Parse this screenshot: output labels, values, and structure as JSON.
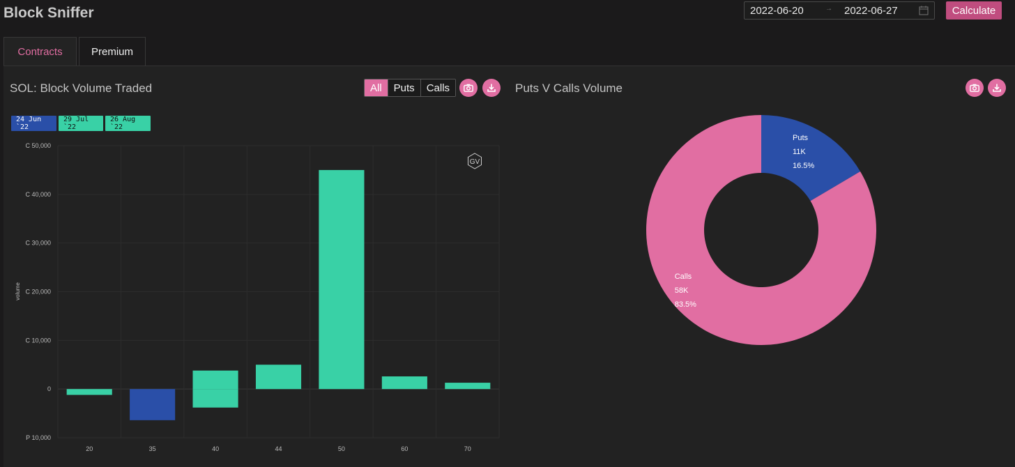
{
  "app": {
    "title": "Block Sniffer"
  },
  "date_range": {
    "start": "2022-06-20",
    "end": "2022-06-27",
    "separator": "→"
  },
  "calculate_label": "Calculate",
  "tabs": [
    {
      "label": "Contracts"
    },
    {
      "label": "Premium"
    }
  ],
  "bar_card": {
    "title": "SOL: Block Volume Traded",
    "filters": [
      "All",
      "Puts",
      "Calls"
    ],
    "active_filter": "All",
    "expiries": [
      {
        "label": "24 Jun `22",
        "color": "#2a4fa8"
      },
      {
        "label": "29 Jul `22",
        "color": "#39d1a6"
      },
      {
        "label": "26 Aug `22",
        "color": "#39d1a6"
      }
    ],
    "watermark": "GV"
  },
  "donut_card": {
    "title": "Puts V Calls Volume"
  },
  "colors": {
    "accent": "#e16ea2",
    "puts": "#2a4fa8",
    "calls_bar": "#39d1a6",
    "calls_pie": "#e16ea2"
  },
  "chart_data": [
    {
      "type": "bar",
      "ylabel": "volume",
      "categories": [
        "20",
        "35",
        "40",
        "44",
        "50",
        "60",
        "70"
      ],
      "ylim": [
        -10000,
        50000
      ],
      "yticks": [
        {
          "value": 50000,
          "label": "C 50,000"
        },
        {
          "value": 40000,
          "label": "C 40,000"
        },
        {
          "value": 30000,
          "label": "C 30,000"
        },
        {
          "value": 20000,
          "label": "C 20,000"
        },
        {
          "value": 10000,
          "label": "C 10,000"
        },
        {
          "value": 0,
          "label": "0"
        },
        {
          "value": -10000,
          "label": "P 10,000"
        }
      ],
      "bars": [
        {
          "category": "20",
          "value": -1200,
          "color": "#39d1a6"
        },
        {
          "category": "35",
          "value": -6400,
          "color": "#2a4fa8"
        },
        {
          "category": "40",
          "value": 3800,
          "color": "#39d1a6"
        },
        {
          "category": "40",
          "value": -3800,
          "color": "#39d1a6"
        },
        {
          "category": "44",
          "value": 5000,
          "color": "#39d1a6"
        },
        {
          "category": "50",
          "value": 45000,
          "color": "#39d1a6"
        },
        {
          "category": "60",
          "value": 2600,
          "color": "#39d1a6"
        },
        {
          "category": "70",
          "value": 1300,
          "color": "#39d1a6"
        }
      ]
    },
    {
      "type": "pie",
      "slices": [
        {
          "name": "Puts",
          "value_label": "11K",
          "percent_label": "16.5%",
          "value": 16.5,
          "color": "#2a4fa8"
        },
        {
          "name": "Calls",
          "value_label": "58K",
          "percent_label": "83.5%",
          "value": 83.5,
          "color": "#e16ea2"
        }
      ]
    }
  ]
}
